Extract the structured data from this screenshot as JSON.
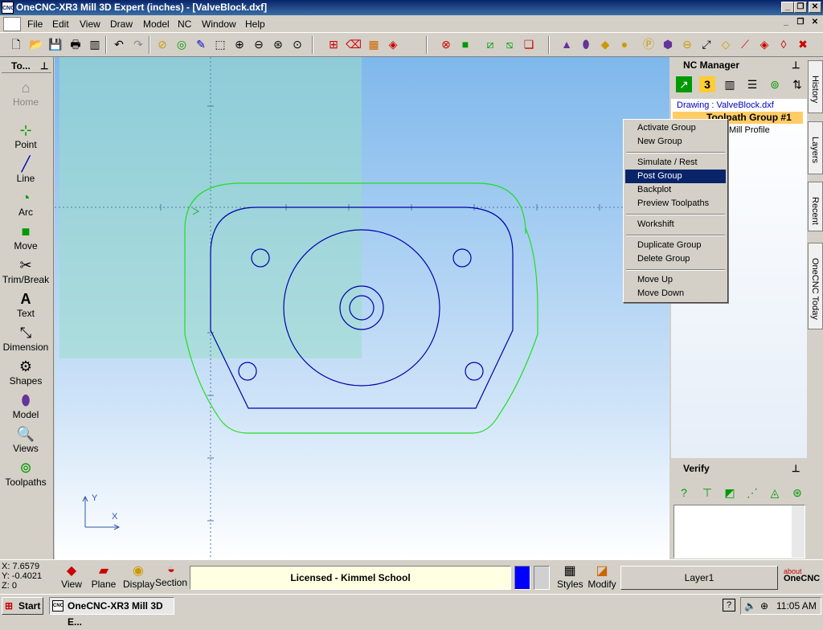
{
  "window": {
    "title": "OneCNC-XR3 Mill 3D Expert (inches) - [ValveBlock.dxf]",
    "app_icon_text": "CNC"
  },
  "menubar": {
    "items": [
      "File",
      "Edit",
      "View",
      "Draw",
      "Model",
      "NC",
      "Window",
      "Help"
    ]
  },
  "left_panel": {
    "title": "To...",
    "home": "Home",
    "tools": [
      "Point",
      "Line",
      "Arc",
      "Move",
      "Trim/Break",
      "Text",
      "Dimension",
      "Shapes",
      "Model",
      "Views",
      "Toolpaths"
    ]
  },
  "nc_manager": {
    "title": "NC Manager",
    "drawing_label": "Drawing : ValveBlock.dxf",
    "group_label": "Toolpath Group #1",
    "child_label": "Mill Profile"
  },
  "context_menu": {
    "items": [
      "Activate Group",
      "New Group",
      "Simulate / Rest",
      "Post Group",
      "Backplot",
      "Preview Toolpaths",
      "Workshift",
      "Duplicate Group",
      "Delete Group",
      "Move Up",
      "Move Down"
    ],
    "selected": "Post Group"
  },
  "verify": {
    "title": "Verify"
  },
  "side_tabs": [
    "History",
    "Layers",
    "Recent",
    "OneCNC Today"
  ],
  "status": {
    "x": "X: 7.6579",
    "y": "Y: -0.4021",
    "z": "Z: 0",
    "buttons": [
      "View",
      "Plane",
      "Display",
      "Section"
    ],
    "license": "Licensed - Kimmel School",
    "styles": "Styles",
    "modify": "Modify",
    "layer": "Layer1",
    "about_small": "about",
    "about_brand": "OneCNC"
  },
  "axis": {
    "x_label": "X",
    "y_label": "Y"
  },
  "taskbar": {
    "start": "Start",
    "task": "OneCNC-XR3 Mill 3D E...",
    "clock": "11:05 AM"
  },
  "colors": {
    "titlebar": "#0a246a",
    "selection": "#0a246a",
    "profile_inner": "#0000aa",
    "profile_outer": "#00cc00",
    "license_bg": "#ffffe1"
  }
}
